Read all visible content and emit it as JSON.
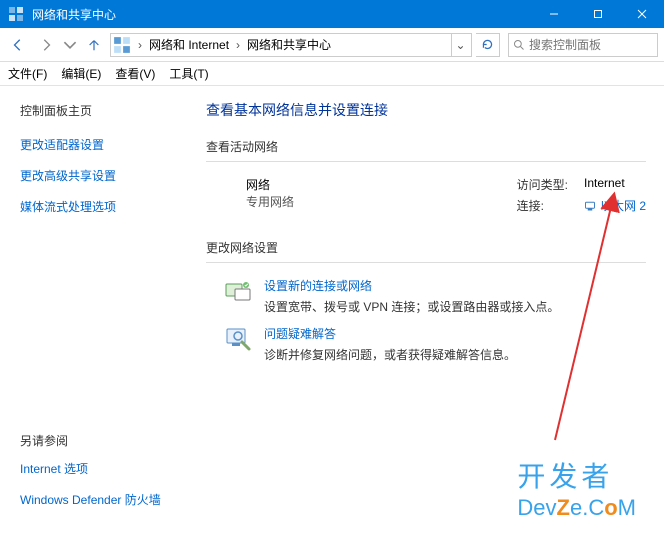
{
  "window": {
    "title": "网络和共享中心"
  },
  "breadcrumb": {
    "seg1": "网络和 Internet",
    "seg2": "网络和共享中心"
  },
  "search": {
    "placeholder": "搜索控制面板"
  },
  "menu": {
    "file": "文件(F)",
    "edit": "编辑(E)",
    "view": "查看(V)",
    "tools": "工具(T)"
  },
  "sidebar": {
    "home": "控制面板主页",
    "adapter": "更改适配器设置",
    "sharing": "更改高级共享设置",
    "streaming": "媒体流式处理选项",
    "see_also": "另请参阅",
    "inet_options": "Internet 选项",
    "firewall": "Windows Defender 防火墙"
  },
  "content": {
    "heading": "查看基本网络信息并设置连接",
    "active_label": "查看活动网络",
    "net_name": "网络",
    "net_type": "专用网络",
    "access_label": "访问类型:",
    "access_value": "Internet",
    "conn_label": "连接:",
    "conn_value": "以太网 2",
    "change_label": "更改网络设置",
    "setup_title": "设置新的连接或网络",
    "setup_desc": "设置宽带、拨号或 VPN 连接；或设置路由器或接入点。",
    "troubleshoot_title": "问题疑难解答",
    "troubleshoot_desc": "诊断并修复网络问题，或者获得疑难解答信息。"
  },
  "watermark": {
    "line1": "开发者",
    "line2a": "Dev",
    "line2b": "Z",
    "line2c": "e.C",
    "line2d": "o",
    "line2e": "M"
  }
}
